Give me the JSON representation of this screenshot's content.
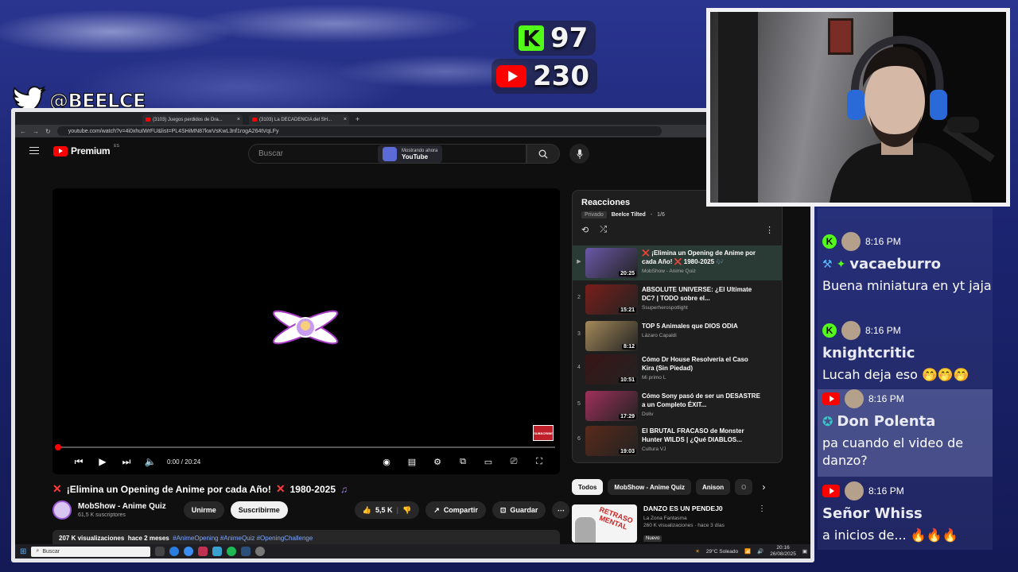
{
  "overlay": {
    "kick_count": "97",
    "youtube_count": "230",
    "twitter_handle": "@BEELCE_"
  },
  "browser": {
    "tabs": [
      {
        "title": "(3103) Juegos perdidos de Dra..."
      },
      {
        "title": "(3103) La DECADENCIA del SH..."
      }
    ],
    "url": "youtube.com/watch?v=4i0xhuIWrFU&list=PL4SHiMN87kwVsKwL3nf1rogA264tVqLFy"
  },
  "youtube": {
    "brand": "Premium",
    "region": "ES",
    "search_placeholder": "Buscar",
    "now_showing_label": "Mostrando ahora",
    "now_showing_value": "YouTube",
    "player": {
      "time": "0:00 / 20:24",
      "progress": 0.0
    },
    "video": {
      "title": "¡Elimina un Opening de Anime por cada Año!",
      "years": "1980-2025",
      "channel": "MobShow - Anime Quiz",
      "subscribers": "61,5 K suscriptores",
      "join_label": "Unirme",
      "subscribe_label": "Suscribirme",
      "likes": "5,5 K",
      "share_label": "Compartir",
      "save_label": "Guardar",
      "views": "207 K visualizaciones",
      "age": "hace 2 meses",
      "tags": "#AnimeOpening #AnimeQuiz #OpeningChallenge"
    },
    "playlist": {
      "title": "Reacciones",
      "privacy": "Privado",
      "owner": "Beelce Tilted",
      "position": "1/6",
      "items": [
        {
          "num": "▶",
          "title": "❌ ¡Elimina un Opening de Anime por cada Año! ❌ 1980-2025 🎶",
          "channel": "MobShow - Anime Quiz",
          "duration": "20:25",
          "color": "#6b58a8"
        },
        {
          "num": "2",
          "title": "ABSOLUTE UNIVERSE: ¿El Ultimate DC? | TODO sobre el...",
          "channel": "Ssuperherospotlight",
          "duration": "15:21",
          "color": "#7a1e1a"
        },
        {
          "num": "3",
          "title": "TOP 5 Animales que DIOS ODIA",
          "channel": "Lázaro Capaldi",
          "duration": "8:12",
          "color": "#a4895a"
        },
        {
          "num": "4",
          "title": "Cómo Dr House Resolvería el Caso Kira (Sin Piedad)",
          "channel": "Mi primo L",
          "duration": "10:51",
          "color": "#3a1516"
        },
        {
          "num": "5",
          "title": "Cómo Sony pasó de ser un DESASTRE a un Completo ÉXIT...",
          "channel": "Doliv",
          "duration": "17:29",
          "color": "#a0305a"
        },
        {
          "num": "6",
          "title": "El BRUTAL FRACASO de Monster Hunter WILDS | ¿Qué DIABLOS...",
          "channel": "Cultura VJ",
          "duration": "19:03",
          "color": "#5a2a1a"
        }
      ]
    },
    "chips": [
      "Todos",
      "MobShow - Anime Quiz",
      "Anison",
      "O"
    ],
    "recommended": {
      "title": "DANZO ES UN PENDEJ0",
      "channel": "La Zona Fantasma",
      "meta": "260 K visualizaciones · hace 3 días",
      "badge": "Nuevo",
      "thumb_text": "RETRASO MENTAL"
    }
  },
  "taskbar": {
    "search_placeholder": "Buscar",
    "weather": "29°C Soleado",
    "time": "20:16",
    "date": "26/08/2025"
  },
  "chat": [
    {
      "platform": "kick",
      "time": "8:16 PM",
      "user": "vacaeburro",
      "text": "Buena miniatura en yt jaja",
      "highlight": false
    },
    {
      "platform": "kick",
      "time": "8:16 PM",
      "user": "knightcritic",
      "text": "Lucah deja eso 🤭🤭🤭",
      "highlight": false
    },
    {
      "platform": "youtube",
      "time": "8:16 PM",
      "user": "Don Polenta",
      "text": "pa cuando el video de danzo?",
      "highlight": true
    },
    {
      "platform": "youtube",
      "time": "8:16 PM",
      "user": "Señor Whiss",
      "text": "a inicios de... 🔥🔥🔥",
      "highlight": false
    }
  ],
  "colors": {
    "kick_green": "#53fc18",
    "youtube_red": "#ff0000",
    "overlay_bg": "#1c2466"
  }
}
